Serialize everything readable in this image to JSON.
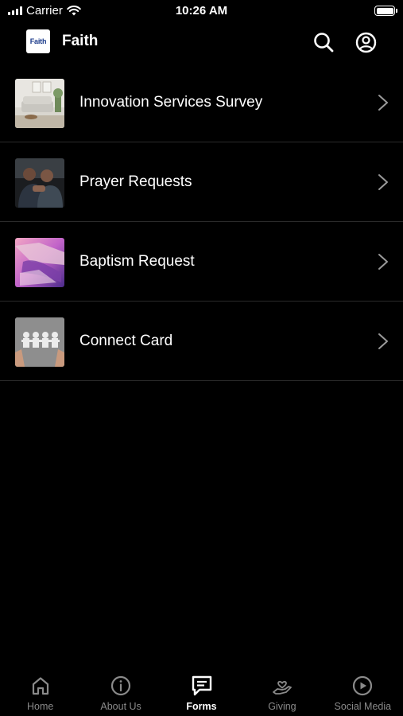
{
  "status_bar": {
    "carrier": "Carrier",
    "time": "10:26 AM"
  },
  "header": {
    "logo_text": "Faith",
    "title": "Faith",
    "icons": [
      "search-icon",
      "account-icon"
    ]
  },
  "forms": [
    {
      "label": "Innovation Services Survey",
      "thumbnail": "living-room-photo"
    },
    {
      "label": "Prayer Requests",
      "thumbnail": "praying-men-photo"
    },
    {
      "label": "Baptism Request",
      "thumbnail": "baptism-painting"
    },
    {
      "label": "Connect Card",
      "thumbnail": "paper-people-photo"
    }
  ],
  "tabs": [
    {
      "label": "Home",
      "icon": "home-icon",
      "active": false
    },
    {
      "label": "About Us",
      "icon": "info-icon",
      "active": false
    },
    {
      "label": "Forms",
      "icon": "forms-icon",
      "active": true
    },
    {
      "label": "Giving",
      "icon": "giving-icon",
      "active": false
    },
    {
      "label": "Social Media",
      "icon": "play-icon",
      "active": false
    }
  ],
  "colors": {
    "background": "#000000",
    "divider": "#2b2b2b",
    "inactive_tab": "#8a8a8a",
    "active_tab": "#ffffff"
  }
}
